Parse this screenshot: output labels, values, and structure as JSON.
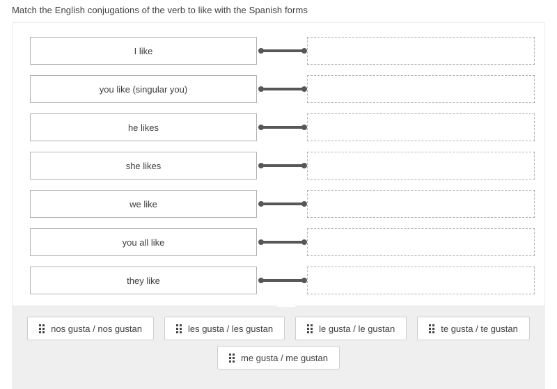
{
  "prompt": "Match the English conjugations of the verb to like with the Spanish forms",
  "panel": {
    "rows": [
      {
        "term": "I like",
        "drop_value": ""
      },
      {
        "term": "you like (singular you)",
        "drop_value": ""
      },
      {
        "term": "he likes",
        "drop_value": ""
      },
      {
        "term": "she likes",
        "drop_value": ""
      },
      {
        "term": "we like",
        "drop_value": ""
      },
      {
        "term": "you all like",
        "drop_value": ""
      },
      {
        "term": "they like",
        "drop_value": ""
      }
    ]
  },
  "answer_bank": {
    "rows": [
      [
        {
          "label": "nos gusta / nos gustan",
          "handle_icon": "drag-handle-icon"
        },
        {
          "label": "les gusta / les gustan",
          "handle_icon": "drag-handle-icon"
        },
        {
          "label": "le gusta / le gustan",
          "handle_icon": "drag-handle-icon"
        },
        {
          "label": "te gusta / te gustan",
          "handle_icon": "drag-handle-icon"
        }
      ],
      [
        {
          "label": "me gusta / me gustan",
          "handle_icon": "drag-handle-icon"
        }
      ]
    ]
  },
  "colors": {
    "text": "#3d3d3d",
    "term_border": "#b3b3b3",
    "dropzone_border": "#b0b0b0",
    "connector": "#575757",
    "tray_background": "#efefef",
    "chip_border": "#cfcfcf",
    "panel_border": "#ececec"
  }
}
